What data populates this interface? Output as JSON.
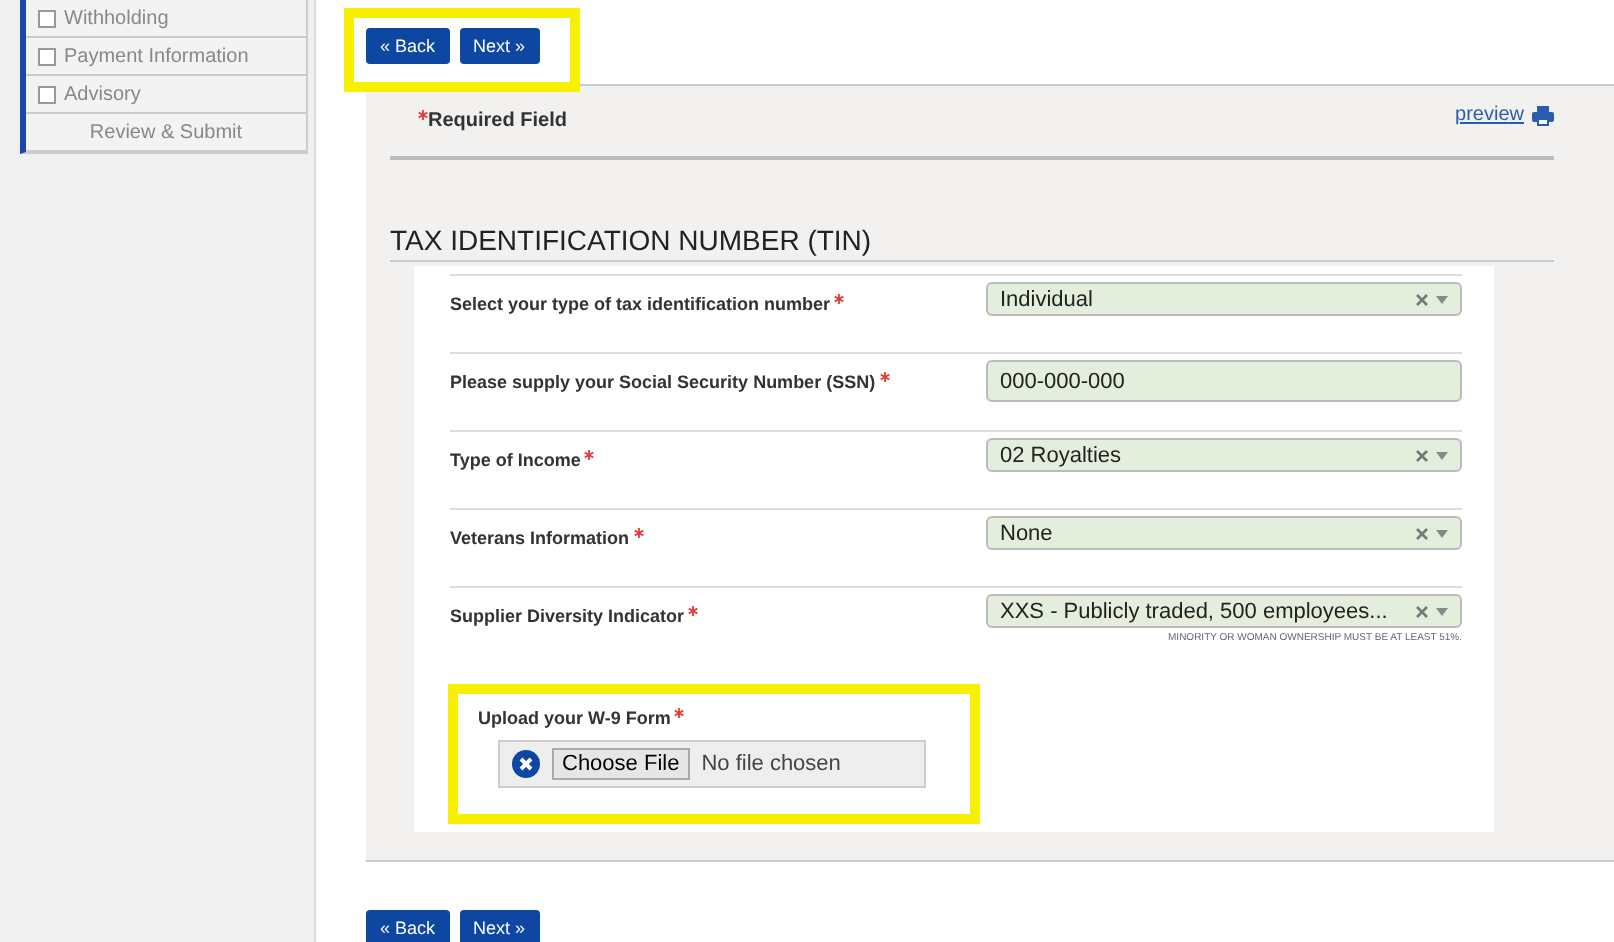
{
  "sidebar": {
    "items": [
      {
        "label": "Withholding",
        "checked": false,
        "kind": "step"
      },
      {
        "label": "Payment Information",
        "checked": false,
        "kind": "step"
      },
      {
        "label": "Advisory",
        "checked": false,
        "kind": "step"
      },
      {
        "label": "Review & Submit",
        "kind": "final"
      }
    ]
  },
  "top_buttons": [
    "« Back",
    "Next »"
  ],
  "required_note": "Required Field",
  "preview_link": "preview",
  "section_title": "TAX IDENTIFICATION NUMBER (TIN)",
  "fields": [
    {
      "kind": "select",
      "label": "Select your type of tax identification number",
      "required": true,
      "value": "Individual"
    },
    {
      "kind": "text",
      "label": "Please supply your Social Security Number (SSN)",
      "required": true,
      "value": "000-000-000"
    },
    {
      "kind": "select",
      "label": "Type of Income",
      "required": true,
      "value": "02 Royalties"
    },
    {
      "kind": "select",
      "label": "Veterans Information",
      "required": true,
      "value": "None"
    },
    {
      "kind": "select",
      "label": "Supplier Diversity Indicator",
      "required": true,
      "value": "XXS - Publicly traded, 500 employees...",
      "hint": "MINORITY OR WOMAN OWNERSHIP MUST BE AT LEAST 51%."
    }
  ],
  "upload": {
    "label": "Upload your W-9 Form",
    "required": true,
    "button": "Choose File",
    "status": "No file chosen"
  },
  "bottom_buttons": [
    "« Back",
    "Next »"
  ]
}
